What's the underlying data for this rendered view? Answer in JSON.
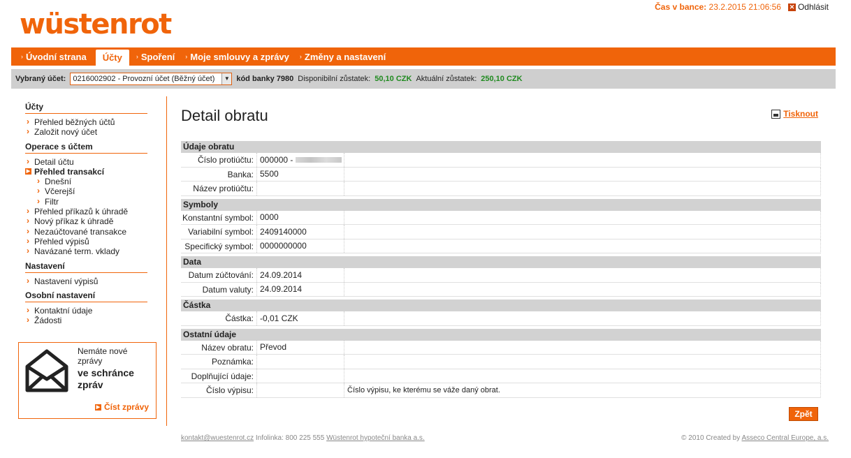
{
  "brand": {
    "logo_text": "wüstenrot",
    "accent": "#f0640a"
  },
  "header": {
    "bank_time_label": "Čas v bance:",
    "bank_time_value": "23.2.2015 21:06:56",
    "logout_label": "Odhlásit"
  },
  "nav": {
    "tabs": [
      {
        "label": "Úvodní strana",
        "active": false
      },
      {
        "label": "Účty",
        "active": true
      },
      {
        "label": "Spoření",
        "active": false
      },
      {
        "label": "Moje smlouvy a zprávy",
        "active": false
      },
      {
        "label": "Změny a nastavení",
        "active": false
      }
    ]
  },
  "account_bar": {
    "selected_label": "Vybraný účet:",
    "selected_value": "0216002902 - Provozní účet (Běžný účet)",
    "bank_code_label": "kód banky 7980",
    "available_label": "Disponibilní zůstatek:",
    "available_value": "50,10 CZK",
    "current_label": "Aktuální zůstatek:",
    "current_value": "250,10 CZK"
  },
  "sidebar": {
    "sections": [
      {
        "title": "Účty",
        "items": [
          "Přehled běžných účtů",
          "Založit nový účet"
        ]
      },
      {
        "title": "Operace s účtem",
        "items": [
          "Detail účtu",
          "Přehled transakcí",
          "Dnešní",
          "Včerejší",
          "Filtr",
          "Přehled příkazů k úhradě",
          "Nový příkaz k úhradě",
          "Nezaúčtované transakce",
          "Přehled výpisů",
          "Navázané term. vklady"
        ]
      },
      {
        "title": "Nastavení",
        "items": [
          "Nastavení výpisů"
        ]
      },
      {
        "title": "Osobní nastavení",
        "items": [
          "Kontaktní údaje",
          "Žádosti"
        ]
      }
    ]
  },
  "messages_box": {
    "line1": "Nemáte nové",
    "line2": "zprávy",
    "line3": "ve schránce",
    "line4": "zpráv",
    "read_label": "Číst zprávy",
    "icon": "envelope-icon"
  },
  "main": {
    "title": "Detail obratu",
    "print_label": "Tisknout",
    "back_label": "Zpět",
    "sections": [
      {
        "title": "Údaje obratu",
        "rows": [
          {
            "label": "Číslo protiúčtu:",
            "value": "000000 -",
            "note": ""
          },
          {
            "label": "Banka:",
            "value": "5500",
            "note": ""
          },
          {
            "label": "Název protiúčtu:",
            "value": "",
            "note": ""
          }
        ]
      },
      {
        "title": "Symboly",
        "rows": [
          {
            "label": "Konstantní symbol:",
            "value": "0000",
            "note": ""
          },
          {
            "label": "Variabilní symbol:",
            "value": "2409140000",
            "note": ""
          },
          {
            "label": "Specifický symbol:",
            "value": "0000000000",
            "note": ""
          }
        ]
      },
      {
        "title": "Data",
        "rows": [
          {
            "label": "Datum zúčtování:",
            "value": "24.09.2014",
            "note": ""
          },
          {
            "label": "Datum valuty:",
            "value": "24.09.2014",
            "note": ""
          }
        ]
      },
      {
        "title": "Částka",
        "rows": [
          {
            "label": "Částka:",
            "value": "-0,01 CZK",
            "note": ""
          }
        ]
      },
      {
        "title": "Ostatní údaje",
        "rows": [
          {
            "label": "Název obratu:",
            "value": "Převod",
            "note": ""
          },
          {
            "label": "Poznámka:",
            "value": "",
            "note": ""
          },
          {
            "label": "Doplňující údaje:",
            "value": "",
            "note": ""
          },
          {
            "label": "Číslo výpisu:",
            "value": "",
            "note": "Číslo výpisu, ke kterému se váže daný obrat."
          }
        ]
      }
    ]
  },
  "footer": {
    "email": "kontakt@wuestenrot.cz",
    "infoline": "Infolinka: 800 225 555",
    "bank_name": "Wüstenrot hypoteční banka a.s.",
    "copyright": "© 2010 Created by",
    "creator": "Asseco Central Europe, a.s."
  }
}
